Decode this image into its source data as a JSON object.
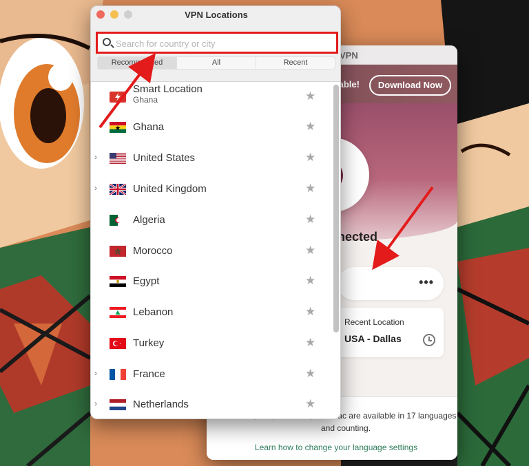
{
  "main_window": {
    "title": "VPN",
    "banner_text": "lable!",
    "download_button": "Download Now",
    "status": "nected",
    "more_menu": "•••",
    "recent_label": "Recent Location",
    "recent_value": "USA - Dallas",
    "language_text": "droid, iOS, Windows, and Mac are available in 17 languages and counting.",
    "language_link": "Learn how to change your language settings"
  },
  "locations_window": {
    "title": "VPN Locations",
    "search_placeholder": "Search for country or city",
    "tabs": [
      "Recommended",
      "All",
      "Recent"
    ],
    "items": [
      {
        "name": "Smart Location",
        "sub": "Ghana",
        "flag": "smart-location",
        "expandable": false
      },
      {
        "name": "Ghana",
        "flag": "ghana",
        "expandable": false
      },
      {
        "name": "United States",
        "flag": "united-states",
        "expandable": true
      },
      {
        "name": "United Kingdom",
        "flag": "united-kingdom",
        "expandable": true
      },
      {
        "name": "Algeria",
        "flag": "algeria",
        "expandable": false
      },
      {
        "name": "Morocco",
        "flag": "morocco",
        "expandable": false
      },
      {
        "name": "Egypt",
        "flag": "egypt",
        "expandable": false
      },
      {
        "name": "Lebanon",
        "flag": "lebanon",
        "expandable": false
      },
      {
        "name": "Turkey",
        "flag": "turkey",
        "expandable": false
      },
      {
        "name": "France",
        "flag": "france",
        "expandable": true
      },
      {
        "name": "Netherlands",
        "flag": "netherlands",
        "expandable": true
      }
    ]
  },
  "colors": {
    "annotation_red": "#e31b1b",
    "accent": "#7a2b4a"
  }
}
